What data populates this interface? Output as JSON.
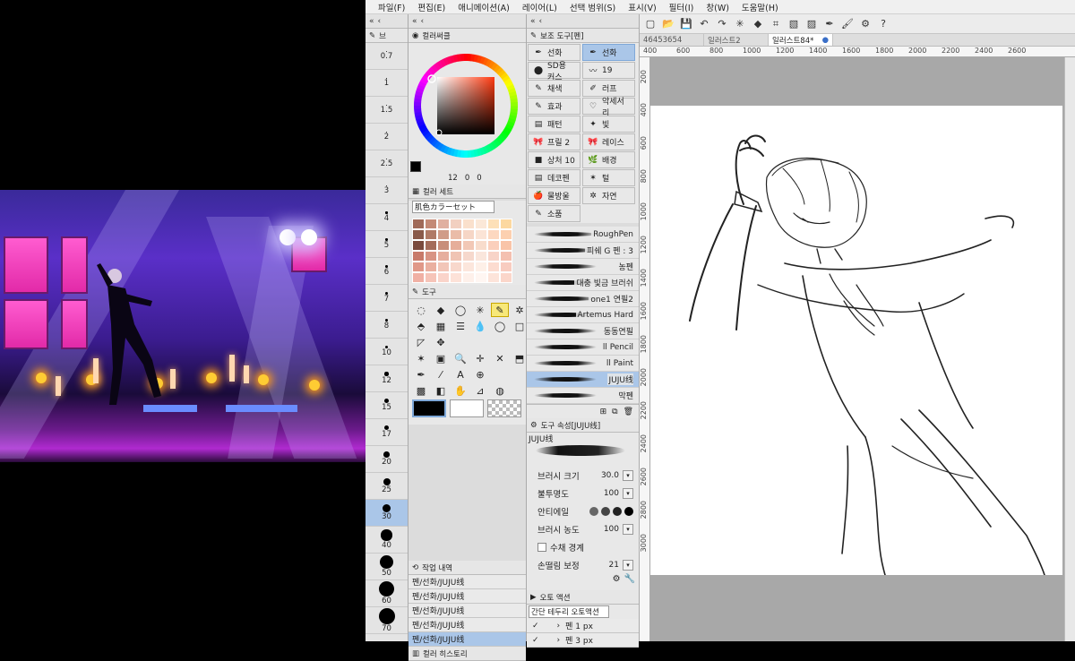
{
  "menu": [
    "파일(F)",
    "편집(E)",
    "애니메이션(A)",
    "레이어(L)",
    "선택 범위(S)",
    "표시(V)",
    "필터(I)",
    "창(W)",
    "도움말(H)"
  ],
  "brush_size": {
    "tab_label": "브",
    "items": [
      "0.7",
      "1",
      "1.5",
      "2",
      "2.5",
      "3",
      "4",
      "5",
      "6",
      "7",
      "8",
      "10",
      "12",
      "15",
      "17",
      "20",
      "25",
      "30",
      "40",
      "50",
      "60",
      "70"
    ],
    "selected": "30"
  },
  "color_wheel": {
    "title": "컬러써클",
    "readout": {
      "h": "12",
      "s": "0",
      "v": "0"
    },
    "fg_color": "#000000",
    "bg_color": "#ffffff"
  },
  "color_set": {
    "title": "컬러 세트",
    "preset": "肌色カラーセット"
  },
  "tool": {
    "title": "도구",
    "icons": [
      "lasso-icon",
      "eraser-icon",
      "select-icon",
      "magic-wand-icon",
      "pen-icon",
      "sparkle-icon",
      "fill-icon",
      "grid-icon",
      "lines-icon",
      "drop-icon",
      "circle-icon",
      "square-icon",
      "correct-icon",
      "move-icon",
      "",
      "",
      "",
      "",
      "ruler-icon",
      "frame-icon",
      "zoom-icon",
      "move-layer-icon",
      "operation-icon",
      "object-icon",
      "brush-icon",
      "eyedropper-icon",
      "text-icon",
      "globe-icon",
      "",
      "",
      "gradient-icon",
      "bucket-icon",
      "blend-icon",
      "shape-icon",
      "balloon-icon",
      ""
    ]
  },
  "history": {
    "title": "작업 내역",
    "items": [
      "펜/선화/JUJU线",
      "펜/선화/JUJU线",
      "펜/선화/JUJU线",
      "펜/선화/JUJU线",
      "펜/선화/JUJU线"
    ],
    "selected_index": 4
  },
  "color_history": {
    "title": "컬러 히스토리"
  },
  "subtool": {
    "title": "보조 도구[펜]",
    "groups": [
      [
        "선화",
        "선화"
      ],
      [
        "SD용 커스",
        "19"
      ],
      [
        "채색",
        "러프"
      ],
      [
        "효과",
        "악세서리"
      ],
      [
        "패턴",
        "빛"
      ],
      [
        "프릴 2",
        "레이스"
      ],
      [
        "상처 10",
        "배경"
      ],
      [
        "데코펜",
        "털"
      ],
      [
        "물방울",
        "자연"
      ],
      [
        "소품",
        ""
      ]
    ],
    "brushes": [
      "RoughPen",
      "피쉐 G 펜 : 3",
      "농펜",
      "대충 빛금 브러쉬",
      "one1 연필2",
      "Artemus Hard",
      "동동연필",
      "ll Pencil",
      "ll Paint",
      "JUJU线",
      "막펜"
    ],
    "selected_brush": "JUJU线"
  },
  "tool_property": {
    "title": "도구 속성[JUJU线]",
    "brush_name": "JUJU线",
    "rows": [
      {
        "label": "브러시 크기",
        "value": "30.0"
      },
      {
        "label": "불투명도",
        "value": "100"
      },
      {
        "label": "안티에일",
        "value": ""
      },
      {
        "label": "브러시 농도",
        "value": "100"
      },
      {
        "label": "수채 경계",
        "value": ""
      },
      {
        "label": "손떨림 보정",
        "value": "21"
      }
    ]
  },
  "auto_action": {
    "title": "오토 액션",
    "preset": "간단 테두리 오토액션",
    "items": [
      "펜 1 px",
      "펜 3 px"
    ]
  },
  "tabs": [
    {
      "label": "46453654",
      "active": false
    },
    {
      "label": "일러스트2",
      "active": false
    },
    {
      "label": "일러스트84*",
      "active": true
    }
  ],
  "ruler_top": [
    "400",
    "600",
    "800",
    "1000",
    "1200",
    "1400",
    "1600",
    "1800",
    "2000",
    "2200",
    "2400",
    "2600"
  ],
  "ruler_left": [
    "200",
    "400",
    "600",
    "800",
    "1000",
    "1200",
    "1400",
    "1600",
    "1800",
    "2000",
    "2200",
    "2400",
    "2600",
    "2800",
    "3000"
  ]
}
